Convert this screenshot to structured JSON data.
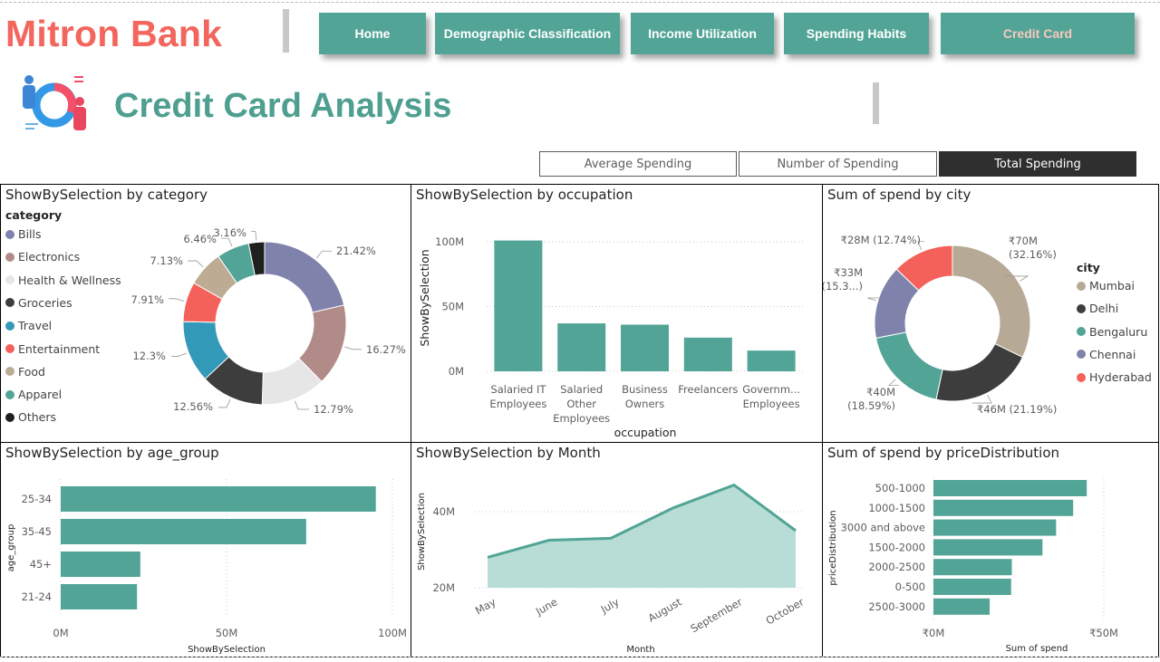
{
  "header": {
    "bank_name": "Mitron Bank",
    "page_title": "Credit Card Analysis",
    "nav": [
      "Home",
      "Demographic Classification",
      "Income Utilization",
      "Spending Habits",
      "Credit Card"
    ],
    "active_nav": "Credit Card",
    "segments": [
      "Average Spending",
      "Number of Spending",
      "Total Spending"
    ],
    "active_segment": "Total Spending",
    "logo_icon": "people-donut-icon"
  },
  "colors": {
    "accent": "#52a596",
    "brand_red": "#f2665e",
    "title_teal": "#4f9f91"
  },
  "category_panel": {
    "title": "ShowBySelection by category",
    "legend_title": "category"
  },
  "occupation_panel": {
    "title": "ShowBySelection by occupation"
  },
  "city_panel": {
    "title": "Sum of spend by city",
    "legend_title": "city"
  },
  "age_panel": {
    "title": "ShowBySelection by age_group"
  },
  "month_panel": {
    "title": "ShowBySelection by Month"
  },
  "price_panel": {
    "title": "Sum of spend by priceDistribution"
  },
  "chart_data": [
    {
      "id": "category",
      "type": "pie",
      "title": "ShowBySelection by category",
      "legend_title": "category",
      "legend_position": "left",
      "categories": [
        "Bills",
        "Electronics",
        "Health & Wellness",
        "Groceries",
        "Travel",
        "Entertainment",
        "Food",
        "Apparel",
        "Others"
      ],
      "values": [
        21.42,
        16.27,
        12.79,
        12.56,
        12.3,
        7.91,
        7.13,
        6.46,
        3.16
      ],
      "labels": [
        "21.42%",
        "16.27%",
        "12.79%",
        "12.56%",
        "12.3%",
        "7.91%",
        "7.13%",
        "6.46%",
        "3.16%"
      ],
      "colors": [
        "#7f83ab",
        "#b08b88",
        "#e6e6e6",
        "#3d3d3d",
        "#3399b8",
        "#f4615b",
        "#bdab94",
        "#52a596",
        "#1f1f1f"
      ]
    },
    {
      "id": "occupation",
      "type": "bar",
      "title": "ShowBySelection by occupation",
      "xlabel": "occupation",
      "ylabel": "ShowBySelection",
      "categories": [
        [
          "Salaried IT",
          "Employees"
        ],
        [
          "Salaried",
          "Other",
          "Employees"
        ],
        [
          "Business",
          "Owners"
        ],
        [
          "Freelancers"
        ],
        [
          "Governm...",
          "Employees"
        ]
      ],
      "values": [
        101,
        37,
        36,
        26,
        16
      ],
      "yticks": [
        "0M",
        "50M",
        "100M"
      ],
      "ylim": [
        0,
        110
      ],
      "grid": true,
      "color": "#52a596"
    },
    {
      "id": "city",
      "type": "pie",
      "title": "Sum of spend by city",
      "legend_title": "city",
      "legend_position": "right",
      "categories": [
        "Mumbai",
        "Delhi",
        "Bengaluru",
        "Chennai",
        "Hyderabad"
      ],
      "values": [
        32.16,
        21.19,
        18.59,
        15.3,
        12.74
      ],
      "labels": [
        [
          "₹70M",
          "(32.16%)"
        ],
        [
          "₹46M (21.19%)"
        ],
        [
          "₹40M",
          "(18.59%)"
        ],
        [
          "₹33M",
          "(15.3...)"
        ],
        [
          "₹28M (12.74%)"
        ]
      ],
      "colors": [
        "#b6a996",
        "#3d3d3d",
        "#52a596",
        "#7f83ab",
        "#f4615b"
      ]
    },
    {
      "id": "age_group",
      "type": "bar",
      "orientation": "horizontal",
      "title": "ShowBySelection by age_group",
      "xlabel": "ShowBySelection",
      "ylabel": "age_group",
      "categories": [
        "25-34",
        "35-45",
        "45+",
        "21-24"
      ],
      "values": [
        95,
        74,
        24,
        23
      ],
      "xticks": [
        "0M",
        "50M",
        "100M"
      ],
      "xlim": [
        0,
        100
      ],
      "grid": true,
      "color": "#52a596"
    },
    {
      "id": "month",
      "type": "area",
      "title": "ShowBySelection by Month",
      "xlabel": "Month",
      "ylabel": "ShowBySelection",
      "categories": [
        "May",
        "June",
        "July",
        "August",
        "September",
        "October"
      ],
      "values": [
        28,
        32.5,
        33,
        41,
        47,
        35
      ],
      "yticks": [
        "20M",
        "40M"
      ],
      "ylim": [
        20,
        50
      ],
      "grid": true,
      "color": "#52a596",
      "fill": "#b8ddd6"
    },
    {
      "id": "price_distribution",
      "type": "bar",
      "orientation": "horizontal",
      "title": "Sum of spend by priceDistribution",
      "xlabel": "Sum of spend",
      "ylabel": "priceDistribution",
      "categories": [
        "500-1000",
        "1000-1500",
        "3000 and above",
        "1500-2000",
        "2000-2500",
        "0-500",
        "2500-3000"
      ],
      "values": [
        45,
        41,
        36,
        32,
        23,
        22.8,
        16.5
      ],
      "xticks": [
        "₹0M",
        "₹50M"
      ],
      "xlim": [
        0,
        50
      ],
      "grid": true,
      "color": "#52a596"
    }
  ]
}
